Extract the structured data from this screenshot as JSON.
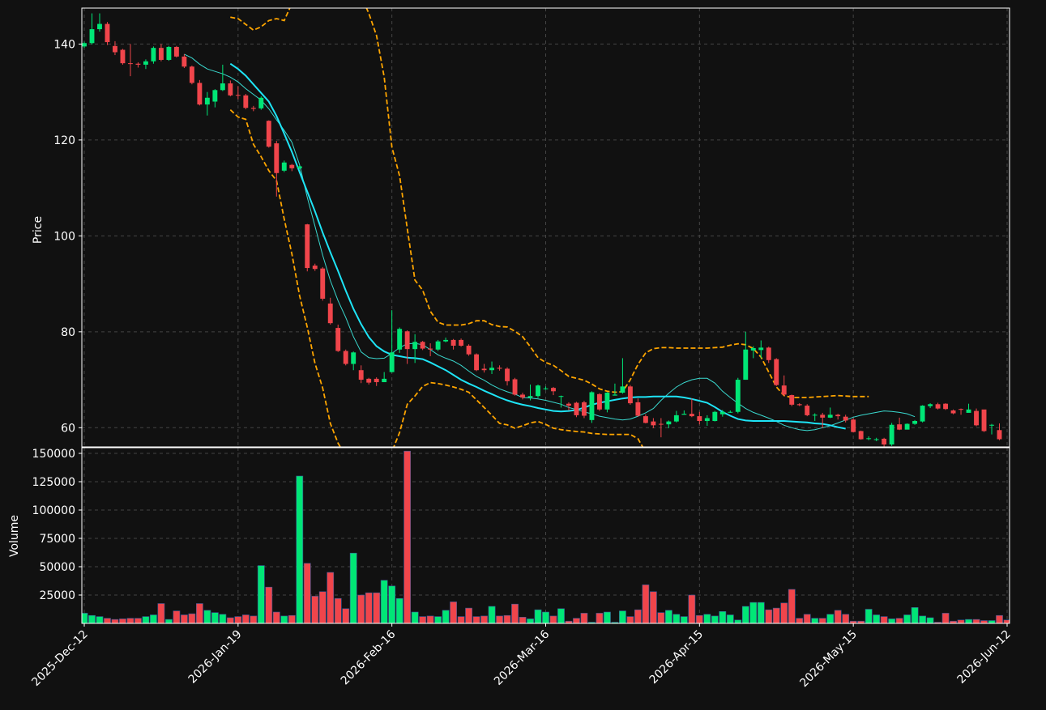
{
  "chart_data": {
    "type": "candlestick",
    "title": "",
    "price_panel": {
      "ylabel": "Price",
      "ylim": [
        56,
        147.5
      ],
      "yticks": [
        60,
        80,
        100,
        120,
        140
      ],
      "grid": true
    },
    "volume_panel": {
      "ylabel": "Volume",
      "ylim": [
        0,
        155000
      ],
      "yticks": [
        25000,
        50000,
        75000,
        100000,
        125000,
        150000
      ],
      "grid": true
    },
    "x_tick_labels": [
      "2025-Dec-12",
      "2026-Jan-19",
      "2026-Feb-16",
      "2026-Mar-16",
      "2026-Apr-15",
      "2026-May-15",
      "2026-Jun-12"
    ],
    "x_tick_index": [
      0,
      20,
      40,
      60,
      80,
      100,
      120
    ],
    "colors": {
      "up": "#00e676",
      "down": "#f0454b",
      "ma_fast": "#3ad9cf",
      "ma_slow": "#1ee4f6",
      "bands": "#ffa500",
      "background": "#111111",
      "grid": "#444444"
    },
    "candles": {
      "open": [
        139.5,
        140.2,
        143.1,
        144.2,
        139.6,
        138.8,
        136.0,
        135.9,
        135.7,
        136.4,
        139.2,
        136.7,
        139.4,
        137.4,
        135.3,
        131.9,
        127.4,
        128.0,
        130.4,
        131.8,
        129.4,
        129.3,
        126.7,
        126.6,
        124.0,
        119.3,
        113.6,
        114.8,
        114.1,
        102.4,
        93.8,
        93.2,
        85.9,
        80.8,
        76.0,
        73.3,
        72.0,
        70.2,
        70.2,
        69.5,
        71.6,
        76.3,
        80.1,
        76.4,
        77.9,
        76.5,
        76.3,
        78.0,
        78.3,
        78.3,
        77.1,
        75.3,
        72.3,
        72.0,
        72.5,
        72.3,
        70.1,
        66.9,
        66.3,
        66.6,
        68.2,
        68.3,
        66.6,
        65.0,
        65.2,
        65.3,
        61.6,
        67.0,
        63.8,
        66.7,
        67.3,
        68.6,
        65.3,
        62.4,
        61.3,
        60.8,
        60.7,
        61.3,
        62.7,
        62.9,
        62.4,
        61.4,
        61.4,
        62.8,
        63.3,
        63.3,
        70.0,
        76.1,
        76.2,
        76.7,
        74.3,
        68.8,
        66.8,
        64.9,
        64.6,
        62.7,
        62.7,
        62.1,
        62.7,
        62.3,
        61.7,
        59.3,
        57.8,
        57.6,
        57.7,
        56.5,
        60.7,
        59.6,
        60.8,
        61.3,
        64.5,
        64.9,
        65.0,
        63.6,
        63.9,
        63.1,
        63.5,
        63.8,
        60.5,
        59.5,
        60.6
      ],
      "close": [
        140.2,
        143.1,
        144.2,
        140.4,
        138.3,
        136.0,
        135.9,
        135.7,
        136.4,
        139.2,
        136.7,
        139.4,
        137.4,
        135.3,
        131.9,
        127.4,
        128.8,
        130.4,
        131.8,
        129.3,
        129.3,
        126.7,
        126.5,
        128.8,
        118.6,
        113.1,
        115.3,
        114.1,
        114.5,
        93.3,
        93.1,
        86.9,
        81.8,
        76.0,
        73.3,
        75.7,
        70.0,
        69.4,
        69.5,
        70.2,
        75.7,
        80.6,
        76.4,
        77.9,
        76.5,
        76.3,
        78.0,
        78.3,
        77.1,
        77.1,
        75.3,
        72.0,
        72.0,
        72.5,
        72.3,
        69.7,
        66.9,
        66.3,
        66.6,
        68.8,
        68.2,
        67.6,
        66.6,
        64.6,
        62.6,
        62.5,
        67.4,
        63.8,
        67.3,
        66.9,
        68.6,
        65.1,
        62.5,
        61.0,
        60.5,
        60.7,
        61.3,
        62.6,
        62.9,
        62.4,
        61.4,
        62.0,
        63.3,
        63.3,
        63.3,
        70.0,
        76.3,
        76.6,
        76.7,
        74.1,
        68.9,
        66.9,
        64.8,
        64.7,
        62.6,
        62.7,
        62.1,
        62.7,
        62.4,
        61.5,
        59.1,
        57.6,
        57.8,
        57.6,
        56.5,
        60.6,
        59.6,
        60.8,
        61.4,
        64.6,
        64.9,
        64.0,
        63.9,
        63.0,
        63.8,
        63.8,
        60.5,
        59.3,
        60.6,
        57.6
      ],
      "high": [
        140.5,
        146.4,
        146.4,
        144.6,
        140.6,
        139.0,
        140.0,
        136.2,
        136.8,
        139.5,
        140.0,
        139.6,
        139.6,
        137.9,
        135.5,
        132.5,
        130.0,
        130.6,
        135.7,
        132.4,
        131.2,
        129.6,
        127.1,
        129.1,
        124.1,
        119.8,
        115.7,
        115.0,
        114.7,
        102.5,
        94.2,
        93.5,
        87.1,
        81.5,
        76.3,
        75.9,
        73.0,
        70.4,
        70.5,
        71.6,
        84.5,
        80.9,
        80.3,
        79.5,
        78.1,
        77.6,
        78.3,
        78.8,
        78.5,
        78.6,
        77.4,
        75.5,
        73.3,
        73.8,
        73.0,
        72.6,
        70.4,
        67.3,
        69.0,
        69.0,
        68.6,
        68.5,
        66.7,
        65.3,
        65.4,
        65.6,
        67.6,
        67.2,
        67.4,
        69.2,
        74.5,
        68.9,
        66.1,
        62.8,
        62.0,
        62.0,
        61.5,
        63.5,
        63.6,
        66.1,
        63.3,
        62.6,
        63.5,
        63.7,
        63.6,
        70.4,
        80.0,
        77.0,
        78.2,
        76.9,
        74.5,
        70.9,
        66.9,
        65.1,
        64.9,
        63.0,
        63.1,
        64.2,
        62.9,
        62.7,
        62.0,
        59.4,
        58.2,
        57.9,
        57.9,
        61.0,
        62.1,
        60.9,
        61.6,
        64.7,
        65.1,
        65.2,
        65.1,
        63.8,
        64.0,
        65.0,
        64.0,
        60.5,
        60.8,
        60.9
      ],
      "low": [
        139.2,
        139.9,
        142.6,
        139.8,
        137.7,
        135.7,
        133.3,
        135.1,
        134.8,
        135.9,
        136.4,
        136.5,
        137.2,
        135.0,
        131.6,
        127.2,
        125.1,
        126.8,
        130.2,
        129.1,
        128.5,
        126.4,
        126.0,
        126.3,
        118.4,
        108.2,
        113.3,
        113.5,
        113.9,
        92.6,
        92.7,
        86.5,
        81.5,
        75.8,
        73.0,
        72.0,
        69.3,
        69.0,
        68.7,
        69.5,
        71.5,
        75.6,
        73.3,
        73.5,
        76.2,
        74.9,
        76.0,
        77.8,
        76.3,
        76.9,
        75.0,
        71.8,
        71.5,
        71.2,
        71.9,
        68.8,
        66.7,
        65.9,
        65.7,
        66.2,
        67.9,
        66.8,
        64.2,
        63.6,
        62.2,
        62.0,
        61.0,
        63.5,
        63.2,
        66.7,
        67.1,
        64.8,
        62.3,
        60.9,
        59.9,
        58.0,
        59.9,
        61.1,
        62.7,
        62.2,
        60.7,
        60.4,
        61.3,
        62.3,
        63.1,
        63.0,
        70.0,
        74.5,
        74.5,
        73.5,
        68.7,
        66.6,
        64.5,
        64.5,
        62.4,
        61.4,
        59.9,
        62.0,
        61.7,
        61.1,
        59.0,
        57.5,
        57.4,
        57.2,
        55.8,
        56.2,
        59.5,
        59.8,
        60.6,
        61.1,
        64.1,
        63.8,
        63.7,
        62.8,
        62.7,
        63.4,
        60.3,
        59.1,
        58.6,
        57.4
      ]
    },
    "volume": [
      9000,
      7000,
      6000,
      4500,
      3500,
      4000,
      4500,
      4500,
      6000,
      7500,
      17500,
      3500,
      11000,
      7500,
      8500,
      17500,
      11500,
      9500,
      8000,
      5000,
      6000,
      7500,
      6500,
      51000,
      32000,
      10000,
      6500,
      7000,
      130000,
      53000,
      24000,
      28000,
      45000,
      22000,
      13000,
      62000,
      25000,
      27000,
      27000,
      38000,
      33000,
      22000,
      152000,
      10000,
      6000,
      6500,
      6000,
      11500,
      19000,
      6000,
      13500,
      6000,
      6500,
      15000,
      6500,
      7000,
      17000,
      5500,
      4000,
      12000,
      10000,
      6500,
      13000,
      2000,
      4500,
      9000,
      1000,
      9000,
      10000,
      1000,
      11000,
      6000,
      12000,
      34000,
      28000,
      9500,
      11500,
      8000,
      6000,
      25000,
      7000,
      8000,
      6500,
      10500,
      7500,
      3000,
      15000,
      18500,
      18500,
      12000,
      13500,
      18000,
      30000,
      4500,
      8000,
      4500,
      4500,
      8000,
      11500,
      8000,
      2000,
      2000,
      12500,
      7500,
      6000,
      4000,
      4500,
      7500,
      14000,
      6500,
      5000,
      1000,
      9000,
      2000,
      3000,
      3500,
      3500,
      2500,
      2500,
      7000,
      3000,
      4000
    ],
    "ma_fast": [
      null,
      null,
      null,
      null,
      null,
      null,
      null,
      null,
      null,
      null,
      null,
      null,
      null,
      137.9,
      137.1,
      135.8,
      134.8,
      134.3,
      133.8,
      133.1,
      132.1,
      130.7,
      129.5,
      128.3,
      126.5,
      124.2,
      122.0,
      119.5,
      114.8,
      108.0,
      102.0,
      96.0,
      90.7,
      86.5,
      83.0,
      79.0,
      75.8,
      74.6,
      74.4,
      74.5,
      75.5,
      76.7,
      77.5,
      77.6,
      77.3,
      76.3,
      75.2,
      74.5,
      73.9,
      73.0,
      71.8,
      70.7,
      69.9,
      68.9,
      68.1,
      67.5,
      67.0,
      66.3,
      66.2,
      66.0,
      65.7,
      65.3,
      64.9,
      64.2,
      63.8,
      63.3,
      62.9,
      62.4,
      62.1,
      61.8,
      61.6,
      61.8,
      62.4,
      63.1,
      64.0,
      65.7,
      67.2,
      68.5,
      69.4,
      70.0,
      70.3,
      70.3,
      69.3,
      67.6,
      66.3,
      65.1,
      64.0,
      63.2,
      62.6,
      62.0,
      61.3,
      60.5,
      60.0,
      59.6,
      59.4,
      59.6,
      60.0,
      60.4,
      61.0,
      61.6,
      62.2,
      62.6,
      62.9,
      63.2,
      63.5,
      63.4,
      63.2,
      62.9,
      62.3
    ],
    "ma_slow": [
      null,
      null,
      null,
      null,
      null,
      null,
      null,
      null,
      null,
      null,
      null,
      null,
      null,
      null,
      null,
      null,
      null,
      null,
      null,
      135.9,
      134.8,
      133.4,
      131.6,
      129.8,
      128.0,
      125.0,
      121.3,
      117.5,
      113.3,
      109.2,
      105.1,
      100.7,
      96.6,
      92.7,
      88.6,
      84.8,
      81.6,
      78.9,
      77.0,
      75.9,
      75.2,
      74.9,
      74.6,
      74.5,
      74.3,
      73.6,
      72.8,
      72.0,
      71.0,
      70.0,
      69.2,
      68.5,
      67.7,
      67.0,
      66.3,
      65.7,
      65.2,
      64.8,
      64.5,
      64.1,
      63.8,
      63.5,
      63.4,
      63.5,
      63.7,
      64.2,
      64.8,
      65.2,
      65.5,
      65.8,
      66.1,
      66.3,
      66.4,
      66.4,
      66.5,
      66.5,
      66.5,
      66.5,
      66.3,
      66.0,
      65.6,
      65.2,
      64.3,
      63.3,
      62.5,
      61.8,
      61.5,
      61.4,
      61.4,
      61.4,
      61.4,
      61.4,
      61.3,
      61.2,
      61.1,
      60.9,
      60.8,
      60.5,
      60.1,
      59.8
    ],
    "bands_upper": [
      null,
      null,
      null,
      null,
      null,
      null,
      null,
      null,
      null,
      null,
      null,
      null,
      null,
      null,
      null,
      null,
      null,
      null,
      null,
      145.6,
      145.3,
      144.1,
      142.9,
      143.6,
      144.9,
      145.3,
      144.9,
      148.5,
      150.2,
      152.5,
      153.4,
      154.1,
      154.8,
      155.2,
      155.6,
      153.1,
      150.1,
      146.4,
      141.8,
      133.1,
      118.5,
      112.5,
      101.5,
      90.8,
      88.7,
      84.3,
      82.0,
      81.4,
      81.4,
      81.4,
      81.7,
      82.3,
      82.3,
      81.5,
      81.1,
      81.0,
      80.1,
      79.0,
      76.9,
      74.6,
      73.6,
      73.0,
      71.9,
      70.7,
      70.3,
      69.9,
      69.1,
      68.1,
      67.6,
      67.4,
      67.5,
      70.0,
      73.2,
      75.6,
      76.5,
      76.7,
      76.7,
      76.6,
      76.6,
      76.6,
      76.6,
      76.6,
      76.7,
      76.8,
      77.2,
      77.5,
      77.3,
      76.5,
      74.7,
      71.6,
      68.5,
      66.7,
      66.3,
      66.3,
      66.3,
      66.4,
      66.5,
      66.6,
      66.7,
      66.6,
      66.5,
      66.5,
      66.5
    ],
    "bands_lower": [
      null,
      null,
      null,
      null,
      null,
      null,
      null,
      null,
      null,
      null,
      null,
      null,
      null,
      null,
      null,
      null,
      null,
      null,
      null,
      126.3,
      124.8,
      124.3,
      119.1,
      116.5,
      113.6,
      111.5,
      103.5,
      96.2,
      87.5,
      80.9,
      73.4,
      68.3,
      60.9,
      56.8,
      54.1,
      50.5,
      47.0,
      46.0,
      45.0,
      50.0,
      55.0,
      59.0,
      64.9,
      66.6,
      68.6,
      69.4,
      69.2,
      68.9,
      68.5,
      68.0,
      67.4,
      65.8,
      64.2,
      62.6,
      60.9,
      60.6,
      59.9,
      60.4,
      61.0,
      61.3,
      60.7,
      59.9,
      59.6,
      59.4,
      59.2,
      59.1,
      58.8,
      58.7,
      58.6,
      58.6,
      58.6,
      58.6,
      57.7,
      54.9,
      52.5,
      51.5,
      51.5,
      51.6,
      51.7,
      53.8,
      54.9,
      55.2,
      55.3,
      55.3,
      55.4,
      55.2,
      54.5,
      53.2,
      51.9,
      50.9,
      52.8,
      54.9,
      55.8,
      55.9,
      55.9,
      55.9,
      55.9,
      55.8,
      55.6,
      55.4,
      55.2
    ]
  }
}
